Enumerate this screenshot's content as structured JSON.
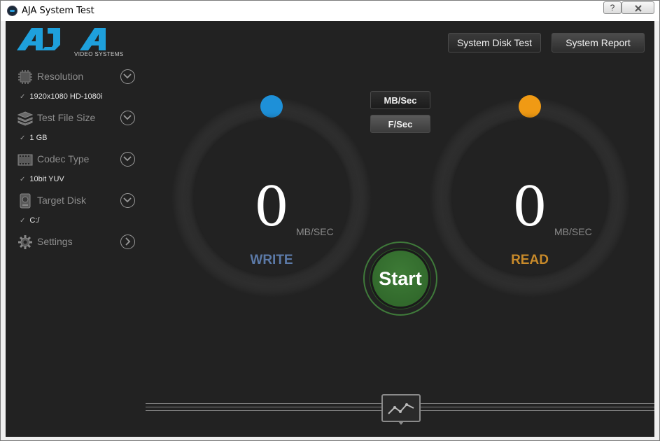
{
  "window": {
    "title": "AJA System Test",
    "help_label": "?",
    "close_icon": "close-icon"
  },
  "logo": {
    "brand": "AJA",
    "subtitle": "VIDEO SYSTEMS",
    "color": "#1ea0dc"
  },
  "sidebar": {
    "items": [
      {
        "label": "Resolution",
        "icon": "chip-icon",
        "value": "1920x1080 HD-1080i",
        "expand": "chevron-down-icon"
      },
      {
        "label": "Test File Size",
        "icon": "stack-icon",
        "value": "1 GB",
        "expand": "chevron-down-icon"
      },
      {
        "label": "Codec Type",
        "icon": "film-icon",
        "value": "10bit YUV",
        "expand": "chevron-down-icon"
      },
      {
        "label": "Target Disk",
        "icon": "disk-icon",
        "value": "C:/",
        "expand": "chevron-down-icon"
      },
      {
        "label": "Settings",
        "icon": "gear-icon",
        "expand": "chevron-right-icon"
      }
    ],
    "check_mark": "✓"
  },
  "toolbar": {
    "system_disk_test": "System Disk Test",
    "system_report": "System Report"
  },
  "units": {
    "mb_sec": "MB/Sec",
    "f_sec": "F/Sec"
  },
  "write_gauge": {
    "value": "0",
    "unit": "MB/SEC",
    "label": "WRITE",
    "label_color": "#5c7aa8",
    "dot_color": "#1e90d8"
  },
  "read_gauge": {
    "value": "0",
    "unit": "MB/SEC",
    "label": "READ",
    "label_color": "#c88a2a",
    "dot_color": "#f09a14"
  },
  "start": {
    "label": "Start",
    "color": "#2f6a2a"
  },
  "graph": {
    "icon": "graph-icon"
  }
}
